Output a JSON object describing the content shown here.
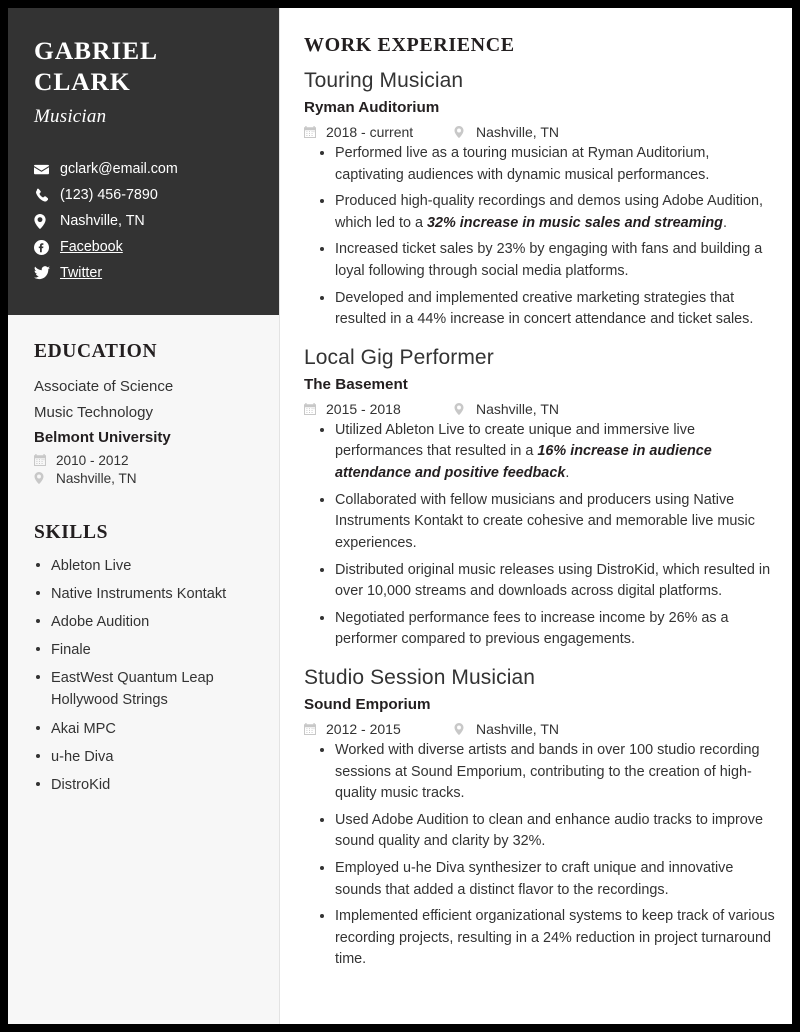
{
  "sidebar": {
    "name": "GABRIEL CLARK",
    "subtitle": "Musician",
    "contacts": [
      {
        "icon": "envelope-icon",
        "text": "gclark@email.com",
        "link": false
      },
      {
        "icon": "phone-icon",
        "text": "(123) 456-7890",
        "link": false
      },
      {
        "icon": "location-pin-icon",
        "text": "Nashville, TN",
        "link": false
      },
      {
        "icon": "facebook-icon",
        "text": "Facebook",
        "link": true
      },
      {
        "icon": "twitter-icon",
        "text": "Twitter",
        "link": true
      }
    ],
    "education": {
      "title": "EDUCATION",
      "degree": "Associate of Science",
      "field": "Music Technology",
      "school": "Belmont University",
      "dates": "2010 - 2012",
      "location": "Nashville, TN"
    },
    "skills": {
      "title": "SKILLS",
      "items": [
        "Ableton Live",
        "Native Instruments Kontakt",
        "Adobe Audition",
        "Finale",
        "EastWest Quantum Leap Hollywood Strings",
        "Akai MPC",
        "u-he Diva",
        "DistroKid"
      ]
    }
  },
  "main": {
    "section_title": "WORK EXPERIENCE",
    "jobs": [
      {
        "title": "Touring Musician",
        "company": "Ryman Auditorium",
        "dates": "2018 - current",
        "location": "Nashville, TN",
        "bullets": [
          {
            "pre": "Performed live as a touring musician at Ryman Auditorium, captivating audiences with dynamic musical performances.",
            "em": "",
            "post": ""
          },
          {
            "pre": "Produced high-quality recordings and demos using Adobe Audition, which led to a ",
            "em": "32% increase in music sales and streaming",
            "post": "."
          },
          {
            "pre": "Increased ticket sales by 23% by engaging with fans and building a loyal following through social media platforms.",
            "em": "",
            "post": ""
          },
          {
            "pre": "Developed and implemented creative marketing strategies that resulted in a 44% increase in concert attendance and ticket sales.",
            "em": "",
            "post": ""
          }
        ]
      },
      {
        "title": "Local Gig Performer",
        "company": "The Basement",
        "dates": "2015 - 2018",
        "location": "Nashville, TN",
        "bullets": [
          {
            "pre": "Utilized Ableton Live to create unique and immersive live performances that resulted in a ",
            "em": "16% increase in audience attendance and positive feedback",
            "post": "."
          },
          {
            "pre": "Collaborated with fellow musicians and producers using Native Instruments Kontakt to create cohesive and memorable live music experiences.",
            "em": "",
            "post": ""
          },
          {
            "pre": "Distributed original music releases using DistroKid, which resulted in over 10,000 streams and downloads across digital platforms.",
            "em": "",
            "post": ""
          },
          {
            "pre": "Negotiated performance fees to increase income by 26% as a performer compared to previous engagements.",
            "em": "",
            "post": ""
          }
        ]
      },
      {
        "title": "Studio Session Musician",
        "company": "Sound Emporium",
        "dates": "2012 - 2015",
        "location": "Nashville, TN",
        "bullets": [
          {
            "pre": "Worked with diverse artists and bands in over 100 studio recording sessions at Sound Emporium, contributing to the creation of high-quality music tracks.",
            "em": "",
            "post": ""
          },
          {
            "pre": "Used Adobe Audition to clean and enhance audio tracks to improve sound quality and clarity by 32%.",
            "em": "",
            "post": ""
          },
          {
            "pre": "Employed u-he Diva synthesizer to craft unique and innovative sounds that added a distinct flavor to the recordings.",
            "em": "",
            "post": ""
          },
          {
            "pre": "Implemented efficient organizational systems to keep track of various recording projects, resulting in a 24% reduction in project turnaround time.",
            "em": "",
            "post": ""
          }
        ]
      }
    ]
  },
  "colors": {
    "header_bg": "#333333",
    "sidebar_bg": "#f7f7f7",
    "page_border": "#000000",
    "text": "#333333",
    "icon_muted": "#c8c8c8"
  }
}
